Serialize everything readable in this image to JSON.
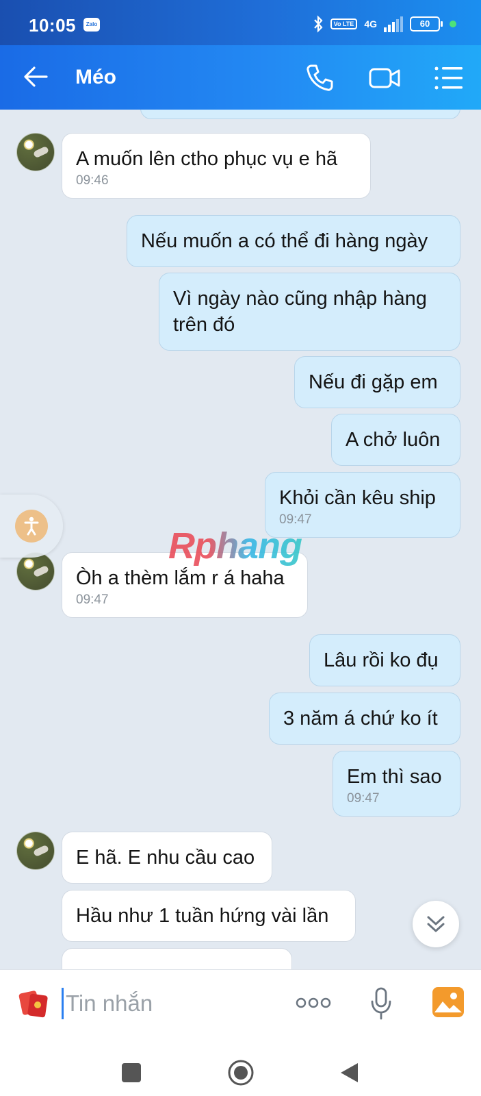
{
  "status_bar": {
    "time": "10:05",
    "app_badge": "Zalo",
    "network": "4G",
    "volte": "Vo LTE",
    "battery": "60"
  },
  "header": {
    "contact_name": "Méo",
    "icons": [
      "back-arrow-icon",
      "phone-icon",
      "video-call-icon",
      "menu-list-icon"
    ]
  },
  "messages": [
    {
      "dir": "in",
      "text": "A muốn lên ctho phục vụ e hã",
      "time": "09:46"
    },
    {
      "dir": "out",
      "text": "Nếu muốn a có thể đi hàng ngày"
    },
    {
      "dir": "out",
      "text": "Vì ngày nào cũng nhập hàng\ntrên đó"
    },
    {
      "dir": "out",
      "text": "Nếu đi gặp em"
    },
    {
      "dir": "out",
      "text": "A chở luôn"
    },
    {
      "dir": "out",
      "text": "Khỏi cần kêu ship",
      "time": "09:47"
    },
    {
      "dir": "in",
      "text": "Òh a thèm lắm r á haha",
      "time": "09:47"
    },
    {
      "dir": "out",
      "text": "Lâu rồi ko đụ"
    },
    {
      "dir": "out",
      "text": "3 năm á chứ ko ít"
    },
    {
      "dir": "out",
      "text": "Em thì sao",
      "time": "09:47"
    },
    {
      "dir": "in",
      "text": "E hã. E nhu cầu cao"
    },
    {
      "dir": "in",
      "text": "Hầu như 1 tuần hứng vài lần"
    }
  ],
  "watermark": "Rphang",
  "input": {
    "placeholder": "Tin nhắn",
    "value": ""
  },
  "colors": {
    "header": "#2389f3",
    "outgoing_bubble": "#d4edfc",
    "incoming_bubble": "#ffffff",
    "chat_background": "#e2e9f1"
  }
}
